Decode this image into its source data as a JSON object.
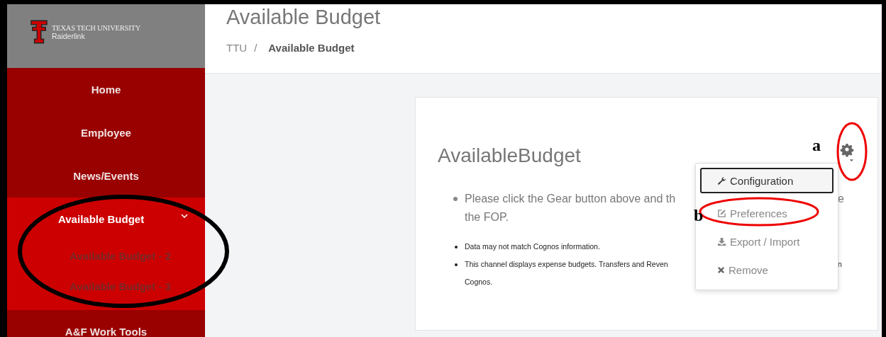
{
  "sidebar": {
    "logo": {
      "line1": "TEXAS TECH UNIVERSITY",
      "line2": "Raiderlink"
    },
    "items": [
      {
        "label": "Home",
        "selected": false,
        "expanded": false
      },
      {
        "label": "Employee",
        "selected": false,
        "expanded": false
      },
      {
        "label": "News/Events",
        "selected": false,
        "expanded": false
      },
      {
        "label": "Available Budget",
        "selected": true,
        "expanded": true,
        "children": [
          {
            "label": "Available Budget - 2",
            "selected": false
          },
          {
            "label": "Available Budget - 3",
            "selected": false
          }
        ]
      },
      {
        "label": "A&F Work Tools",
        "selected": false,
        "expanded": false
      }
    ]
  },
  "header": {
    "title": "Available Budget",
    "breadcrumb": {
      "parent": "TTU",
      "separator": "/",
      "current": "Available Budget"
    }
  },
  "channel": {
    "title": "AvailableBudget",
    "instruction": {
      "line1_left": "Please click the Gear button above and th",
      "line1_right": "e",
      "line2": "the FOP."
    },
    "notes": [
      {
        "left": "Data may not match Cognos information."
      },
      {
        "left": "This channel displays expense budgets. Transfers and Reven",
        "right": "n",
        "continuation": "Cognos."
      }
    ]
  },
  "gear_menu": {
    "items": [
      {
        "label": "Configuration",
        "selected": true
      },
      {
        "label": "Preferences",
        "selected": false
      },
      {
        "label": "Export / Import",
        "selected": false
      },
      {
        "label": "Remove",
        "selected": false
      }
    ]
  },
  "annotations": [
    {
      "label": "a"
    },
    {
      "label": "b"
    }
  ]
}
